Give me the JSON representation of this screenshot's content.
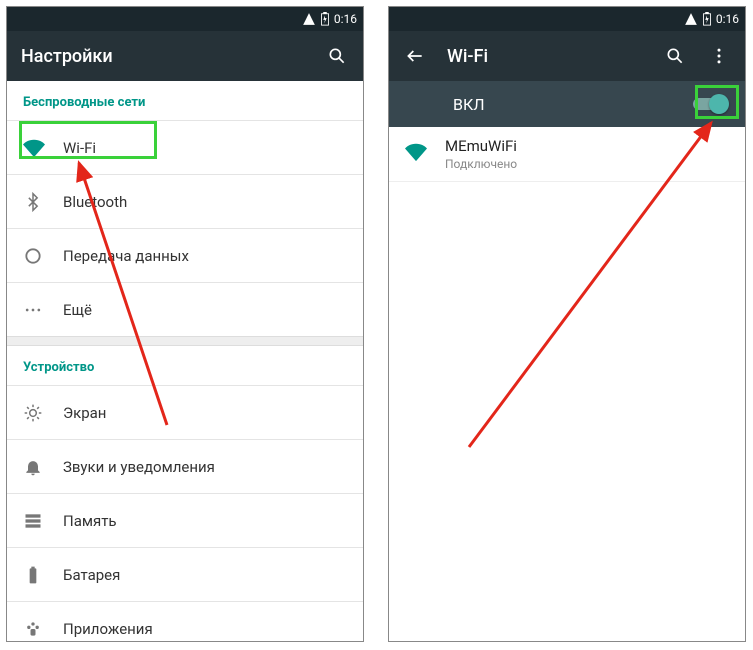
{
  "status": {
    "signal_icon": "signal",
    "battery_icon": "battery-charging",
    "time": "0:16"
  },
  "left": {
    "appbar_title": "Настройки",
    "sections": {
      "wireless_header": "Беспроводные сети",
      "device_header": "Устройство"
    },
    "rows": {
      "wifi": "Wi-Fi",
      "bluetooth": "Bluetooth",
      "data": "Передача данных",
      "more": "Ещё",
      "display": "Экран",
      "sound": "Звуки и уведомления",
      "storage": "Память",
      "battery": "Батарея",
      "apps": "Приложения"
    }
  },
  "right": {
    "appbar_title": "Wi-Fi",
    "toggle_label": "ВКЛ",
    "toggle_on": true,
    "network": {
      "ssid": "MEmuWiFi",
      "status": "Подключено"
    }
  },
  "colors": {
    "accent": "#009688",
    "appbar": "#263238",
    "statusbar": "#1b272d",
    "highlight": "#3ad13a",
    "arrow": "#e3261a"
  }
}
